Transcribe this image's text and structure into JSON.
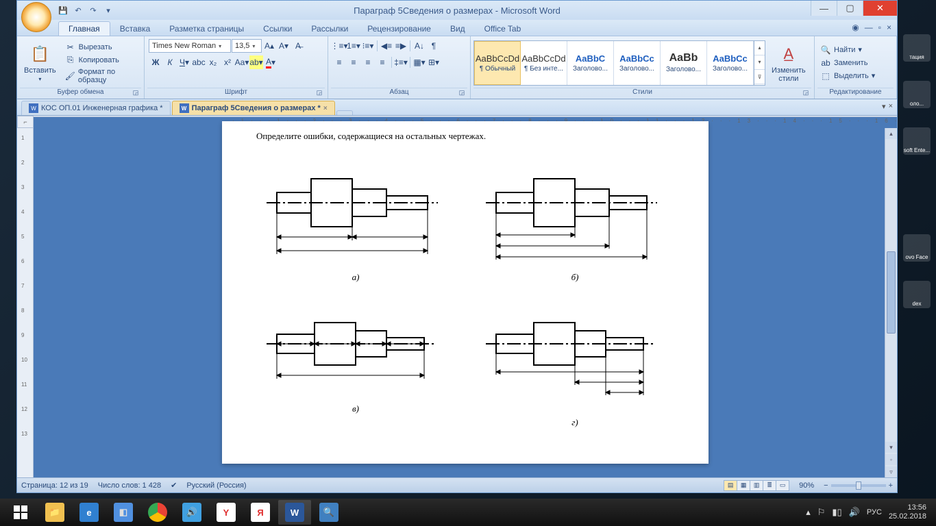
{
  "window": {
    "title": "Параграф 5Сведения о размерах - Microsoft Word"
  },
  "ribbon": {
    "tabs": [
      "Главная",
      "Вставка",
      "Разметка страницы",
      "Ссылки",
      "Рассылки",
      "Рецензирование",
      "Вид",
      "Office Tab"
    ],
    "paste": "Вставить",
    "cut": "Вырезать",
    "copy": "Копировать",
    "format_painter": "Формат по образцу",
    "clipboard_group": "Буфер обмена",
    "font_name": "Times New Roman",
    "font_size": "13,5",
    "font_group": "Шрифт",
    "paragraph_group": "Абзац",
    "styles_group": "Стили",
    "change_styles": "Изменить\nстили",
    "editing_group": "Редактирование",
    "find": "Найти",
    "replace": "Заменить",
    "select": "Выделить",
    "styles": [
      {
        "preview": "AaBbCcDd",
        "name": "¶ Обычный"
      },
      {
        "preview": "AaBbCcDd",
        "name": "¶ Без инте..."
      },
      {
        "preview": "AaBbC",
        "name": "Заголово..."
      },
      {
        "preview": "AaBbCc",
        "name": "Заголово..."
      },
      {
        "preview": "AaBb",
        "name": "Заголово..."
      },
      {
        "preview": "AaBbCc",
        "name": "Заголово..."
      }
    ]
  },
  "doc_tabs": [
    {
      "name": "КОС ОП.01 Инженерная графика *",
      "active": false
    },
    {
      "name": "Параграф 5Сведения о размерах *",
      "active": true
    }
  ],
  "document": {
    "body_text": "Определите ошибки, содержащиеся на остальных чертежах.",
    "labels": [
      "а)",
      "б)",
      "в)",
      "г)"
    ]
  },
  "ruler": {
    "marks": "·1···1···2···3···4···5···6···7···8···9···10···11···12···13···14···15···16···17···18··19··",
    "v_marks": [
      "1",
      "2",
      "3",
      "4",
      "5",
      "6",
      "7",
      "8",
      "9",
      "10",
      "11",
      "12",
      "13"
    ]
  },
  "statusbar": {
    "page": "Страница: 12 из 19",
    "words": "Число слов: 1 428",
    "language": "Русский (Россия)",
    "zoom": "90%"
  },
  "taskbar": {
    "lang": "РУС",
    "time": "13:56",
    "date": "25.02.2018"
  },
  "desktop": {
    "icons": [
      "тация",
      "оло...",
      "soft\nEnte...",
      "ovo\nFace",
      "dex"
    ]
  }
}
